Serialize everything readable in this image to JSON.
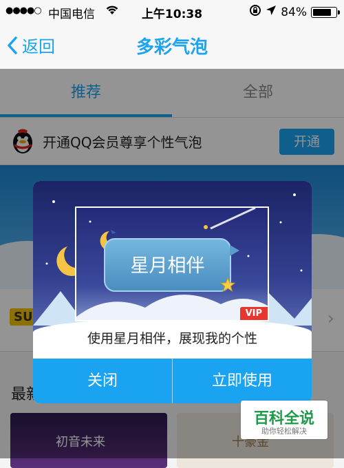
{
  "status_bar": {
    "signal": "●●●●○",
    "carrier": "中国电信",
    "time": "上午10:38",
    "battery_percent_text": "84%",
    "battery_level": 0.84
  },
  "nav": {
    "back_label": "返回",
    "title": "多彩气泡"
  },
  "tabs": [
    {
      "label": "推荐",
      "active": true
    },
    {
      "label": "全部",
      "active": false
    }
  ],
  "vip_banner": {
    "text": "开通QQ会员尊享个性气泡",
    "button_label": "开通"
  },
  "background": {
    "badge_text": "SU",
    "section_label": "最新",
    "card1_label": "初音未来",
    "card2_label": "十豪金"
  },
  "dialog": {
    "bubble_text": "星月相伴",
    "vip_badge": "VIP",
    "description": "使用星月相伴，展现我的个性",
    "close_label": "关闭",
    "use_label": "立即使用"
  },
  "watermark": {
    "title": "百科全说",
    "subtitle": "助你轻松解决"
  },
  "colors": {
    "accent": "#1aa3f0",
    "vip_red": "#e8362f",
    "watermark_green": "#1e9a49"
  },
  "icons": [
    "signal-icon",
    "wifi-icon",
    "lock-rotation-icon",
    "location-arrow-icon",
    "battery-icon",
    "back-chevron-icon",
    "qq-penguin-icon",
    "moon-icon",
    "star-icon",
    "chevron-right-icon"
  ]
}
